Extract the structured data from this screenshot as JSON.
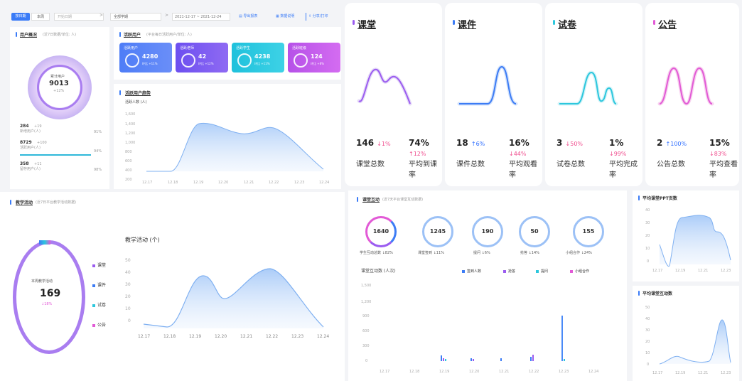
{
  "toolbar": {
    "date_btn": "按日期",
    "range_btn": "本周",
    "date_input_placeholder": "开始日期",
    "arrow": ">",
    "term_value": "全部学期",
    "range_value": "2021-12-17 ~ 2021-12-24",
    "export_btn": "导出报表",
    "data_overview_btn": "数据说明",
    "share_btn": "分享/打印"
  },
  "user_overview": {
    "title": "用户概况",
    "subtitle": "(近7日数据/单位: 人)",
    "center_label": "累计用户",
    "center_value": "9013",
    "center_delta": "+12%",
    "rows": [
      {
        "value": "284",
        "delta": "+19",
        "label": "新增用户(人)",
        "pct": "91%"
      },
      {
        "value": "8729",
        "delta": "+100",
        "label": "活跃用户(人)",
        "pct": "94%"
      },
      {
        "value": "358",
        "delta": "+11",
        "label": "留存用户(人)",
        "pct": "98%"
      }
    ]
  },
  "activity": {
    "title": "活跃用户",
    "subtitle": "(平台每日活跃用户/单位: 人)",
    "kpis": [
      {
        "label": "活跃用户",
        "value": "4280",
        "sub": "环比 +11%",
        "color": "#3f6ff7"
      },
      {
        "label": "活跃老师",
        "value": "42",
        "sub": "环比 +12%",
        "color": "#6a4fe8"
      },
      {
        "label": "活跃学生",
        "value": "4238",
        "sub": "环比 +11%",
        "color": "#22c3dd"
      },
      {
        "label": "活跃班级",
        "value": "124",
        "sub": "环比 +8%",
        "color": "#c658e6"
      }
    ]
  },
  "active_trend": {
    "title": "活跃用户趋势",
    "ylabel": "活跃人数 (人)",
    "yticks": [
      "1,600",
      "1,400",
      "1,200",
      "1,000",
      "800",
      "600",
      "400",
      "200",
      "0"
    ],
    "x": [
      "12.17",
      "12.18",
      "12.19",
      "12.20",
      "12.21",
      "12.22",
      "12.23",
      "12.24"
    ]
  },
  "stat_cards": [
    {
      "title": "课堂",
      "color": "#9b5cf0",
      "v1": "146",
      "d1": "↓1%",
      "d1dir": "down",
      "v2": "74%",
      "d2": "↑12%",
      "d2dir": "up",
      "l1": "课堂总数",
      "l2": "平均到课率"
    },
    {
      "title": "课件",
      "color": "#3c7cf5",
      "v1": "18",
      "d1": "↑6%",
      "d1dir": "up",
      "v2": "16%",
      "d2": "↓44%",
      "d2dir": "down",
      "l1": "课件总数",
      "l2": "平均观看率"
    },
    {
      "title": "试卷",
      "color": "#2cc7dd",
      "v1": "3",
      "d1": "↓50%",
      "d1dir": "down",
      "v2": "1%",
      "d2": "↓99%",
      "d2dir": "down",
      "l1": "试卷总数",
      "l2": "平均完成率"
    },
    {
      "title": "公告",
      "color": "#e25ad6",
      "v1": "2",
      "d1": "↑100%",
      "d1dir": "up",
      "v2": "15%",
      "d2": "↓83%",
      "d2dir": "down",
      "l1": "公告总数",
      "l2": "平均查看率"
    }
  ],
  "teaching": {
    "title": "教学活动",
    "subtitle": "(近7日平台教学活动数据)",
    "center_label": "本周教学活动",
    "center_value": "169",
    "center_delta": "↓18%",
    "legend": [
      "课堂",
      "课件",
      "试卷",
      "公告"
    ],
    "legend_colors": [
      "#9b5cf0",
      "#3c7cf5",
      "#2cc7dd",
      "#e25ad6"
    ],
    "chart_title": "教学活动 (个)",
    "yticks": [
      "50",
      "40",
      "30",
      "20",
      "10",
      "0"
    ],
    "x": [
      "12.17",
      "12.18",
      "12.19",
      "12.20",
      "12.21",
      "12.22",
      "12.23",
      "12.24"
    ]
  },
  "interaction": {
    "title": "课堂互动",
    "subtitle": "(近7天平台课堂互动数据)",
    "circles": [
      {
        "value": "1640",
        "label": "学生互动总数 ↓82%"
      },
      {
        "value": "1245",
        "label": "课堂签到 ↓11%"
      },
      {
        "value": "190",
        "label": "提问 ↓6%"
      },
      {
        "value": "50",
        "label": "抢答 ↓14%"
      },
      {
        "value": "155",
        "label": "小组合作 ↓24%"
      }
    ],
    "chart_title": "课堂互动数 (人次)",
    "legend": [
      "签到人数",
      "抢答",
      "提问",
      "小组合作"
    ],
    "legend_colors": [
      "#3c7cf5",
      "#9b5cf0",
      "#2cc7dd",
      "#e25ad6"
    ],
    "yticks": [
      "1,500",
      "1,200",
      "900",
      "600",
      "300",
      "0"
    ],
    "x": [
      "12.17",
      "12.18",
      "12.19",
      "12.20",
      "12.21",
      "12.22",
      "12.23",
      "12.24"
    ]
  },
  "ppt_chart": {
    "title": "平均课堂PPT页数",
    "yticks": [
      "40",
      "30",
      "20",
      "10",
      "0"
    ],
    "x": [
      "12.17",
      "12.19",
      "12.21",
      "12.23"
    ]
  },
  "interact_chart": {
    "title": "平均课堂互动数",
    "yticks": [
      "50",
      "40",
      "30",
      "20",
      "10",
      "0"
    ],
    "x": [
      "12.17",
      "12.19",
      "12.21",
      "12.23"
    ]
  }
}
